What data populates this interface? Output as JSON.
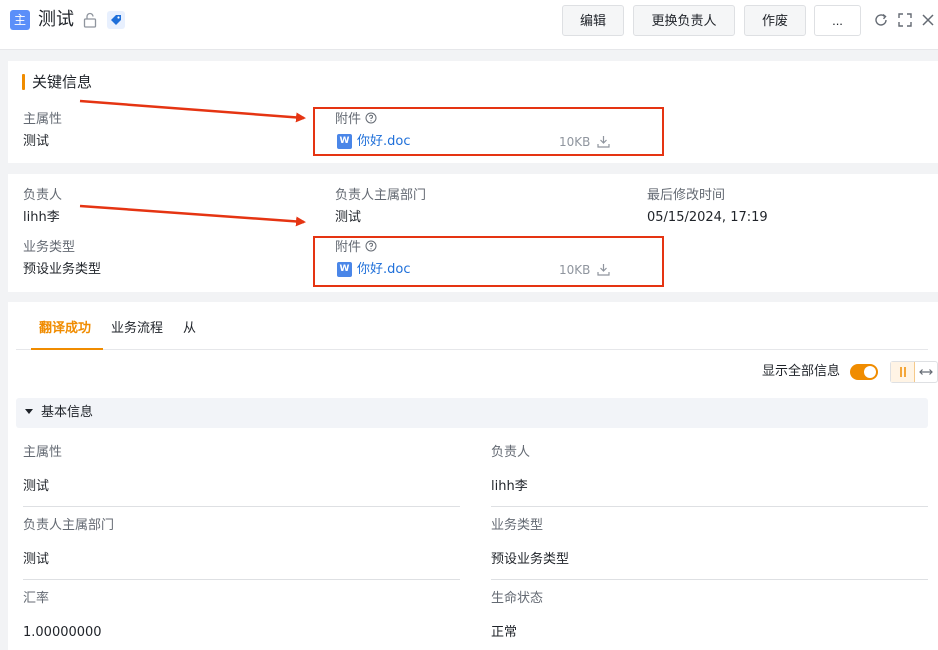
{
  "header": {
    "badge": "主",
    "title": "测试",
    "buttons": {
      "edit": "编辑",
      "change_owner": "更换负责人",
      "void": "作废",
      "more": "..."
    }
  },
  "key_info": {
    "section_title": "关键信息",
    "main_attr_label": "主属性",
    "main_attr_value": "测试",
    "attachment_label": "附件",
    "file_name": "你好.doc",
    "file_size": "10KB"
  },
  "summary": {
    "owner_label": "负责人",
    "owner_value": "lihh李",
    "dept_label": "负责人主属部门",
    "dept_value": "测试",
    "modified_label": "最后修改时间",
    "modified_value": "05/15/2024, 17:19",
    "biz_type_label": "业务类型",
    "biz_type_value": "预设业务类型",
    "attachment_label": "附件",
    "file_name": "你好.doc",
    "file_size": "10KB"
  },
  "tabs": [
    {
      "label": "翻译成功",
      "active": true
    },
    {
      "label": "业务流程"
    },
    {
      "label": "从"
    }
  ],
  "toolbar": {
    "show_all_label": "显示全部信息",
    "show_all_on": true
  },
  "basic_info": {
    "title": "基本信息",
    "fields": [
      {
        "label": "主属性",
        "value": "测试"
      },
      {
        "label": "负责人",
        "value": "lihh李"
      },
      {
        "label": "负责人主属部门",
        "value": "测试"
      },
      {
        "label": "业务类型",
        "value": "预设业务类型"
      },
      {
        "label": "汇率",
        "value": "1.00000000"
      },
      {
        "label": "生命状态",
        "value": "正常"
      }
    ]
  },
  "colors": {
    "accent": "#f08c00",
    "link": "#1e6fd9",
    "highlight_box": "#e53412",
    "badge": "#5b8ff9"
  },
  "icons": [
    "lock-icon",
    "tag-icon",
    "refresh-icon",
    "fullscreen-icon",
    "close-icon",
    "help-icon",
    "word-file-icon",
    "download-icon",
    "caret-down-icon"
  ]
}
